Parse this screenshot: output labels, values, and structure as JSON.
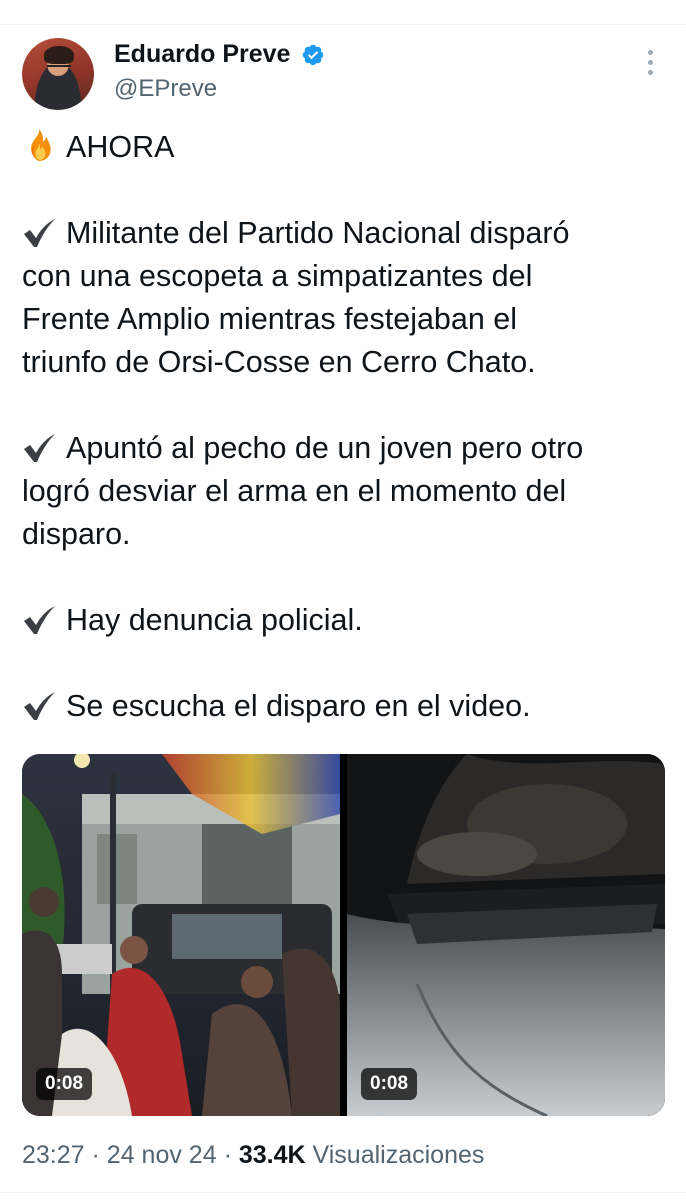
{
  "author": {
    "display_name": "Eduardo Preve",
    "handle": "@EPreve"
  },
  "icons": {
    "verified": "verified-badge-icon",
    "more": "more-options-icon",
    "fire": "fire-emoji-icon",
    "check": "check-mark-icon",
    "brand_blue": "#1d9bf0"
  },
  "tweet": {
    "headline": "AHORA",
    "points": [
      {
        "lines": [
          "Militante del Partido Nacional disparó",
          "con una escopeta a simpatizantes del",
          "Frente Amplio mientras festejaban el",
          "triunfo de Orsi-Cosse en Cerro Chato."
        ]
      },
      {
        "lines": [
          "Apuntó al pecho de un joven pero otro",
          "logró desviar el arma en el momento del",
          "disparo."
        ]
      },
      {
        "lines": [
          "Hay denuncia policial."
        ]
      },
      {
        "lines": [
          "Se escucha el disparo en el video."
        ]
      }
    ]
  },
  "media": [
    {
      "kind": "video",
      "duration": "0:08"
    },
    {
      "kind": "video",
      "duration": "0:08"
    }
  ],
  "meta": {
    "time": "23:27",
    "separator": "·",
    "date": "24 nov 24",
    "views_count": "33.4K",
    "views_label": "Visualizaciones"
  }
}
